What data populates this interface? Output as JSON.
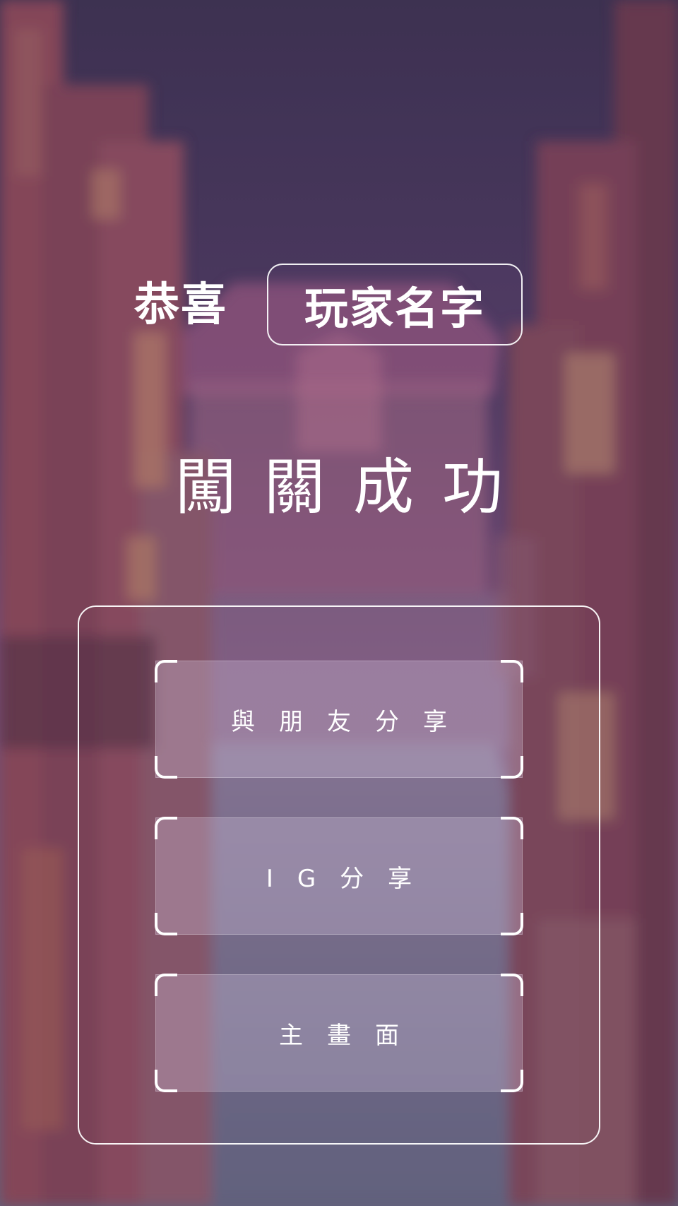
{
  "header": {
    "congrats_text": "恭喜",
    "player_name": "玩家名字"
  },
  "result": {
    "title": "闖關成功"
  },
  "menu": {
    "share_friends_label": "與朋友分享",
    "share_ig_label": "IG分享",
    "main_menu_label": "主畫面"
  },
  "icons": {
    "background": "blurred-street-scene-illustration"
  },
  "colors": {
    "text": "#ffffff",
    "sky_top": "#3d3352",
    "sky_mid": "#6a4a78",
    "street": "#686884",
    "building_left": "#8a4a5c",
    "building_right": "#7a4258"
  }
}
